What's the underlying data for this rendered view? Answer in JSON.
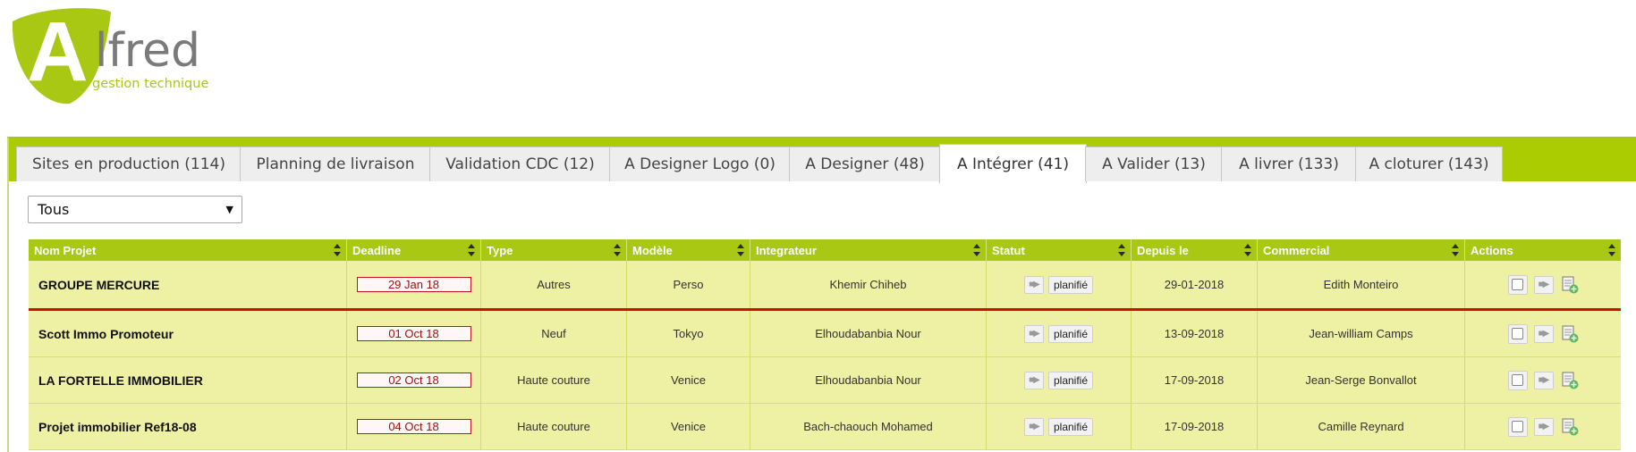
{
  "logo": {
    "letter": "A",
    "name": "lfred",
    "tagline": "gestion technique",
    "brand_color": "#a9c813"
  },
  "tabs": [
    {
      "label": "Sites en production (114)",
      "active": false
    },
    {
      "label": "Planning de livraison",
      "active": false
    },
    {
      "label": "Validation CDC (12)",
      "active": false
    },
    {
      "label": "A Designer Logo (0)",
      "active": false
    },
    {
      "label": "A Designer (48)",
      "active": false
    },
    {
      "label": "A Intégrer (41)",
      "active": true
    },
    {
      "label": "A Valider (13)",
      "active": false
    },
    {
      "label": "A livrer (133)",
      "active": false
    },
    {
      "label": "A cloturer (143)",
      "active": false
    }
  ],
  "filter": {
    "selected": "Tous"
  },
  "table": {
    "columns": [
      "Nom Projet",
      "Deadline",
      "Type",
      "Modèle",
      "Integrateur",
      "Statut",
      "Depuis le",
      "Commercial",
      "Actions"
    ],
    "rows": [
      {
        "name": "GROUPE MERCURE",
        "deadline": "29 Jan 18",
        "type": "Autres",
        "model": "Perso",
        "integrator": "Khemir Chiheb",
        "status": "planifié",
        "since": "29-01-2018",
        "commercial": "Edith Monteiro"
      },
      {
        "name": "Scott Immo Promoteur",
        "deadline": "01 Oct 18",
        "type": "Neuf",
        "model": "Tokyo",
        "integrator": "Elhoudabanbia Nour",
        "status": "planifié",
        "since": "13-09-2018",
        "commercial": "Jean-william Camps"
      },
      {
        "name": "LA FORTELLE IMMOBILIER",
        "deadline": "02 Oct 18",
        "type": "Haute couture",
        "model": "Venice",
        "integrator": "Elhoudabanbia Nour",
        "status": "planifié",
        "since": "17-09-2018",
        "commercial": "Jean-Serge Bonvallot"
      },
      {
        "name": "Projet immobilier Ref18-08",
        "deadline": "04 Oct 18",
        "type": "Haute couture",
        "model": "Venice",
        "integrator": "Bach-chaouch Mohamed",
        "status": "planifié",
        "since": "17-09-2018",
        "commercial": "Camille Reynard"
      }
    ]
  },
  "colors": {
    "accent": "#aacc00",
    "row_bg": "#eef0a4",
    "deadline_red": "#c0141a",
    "separator_red": "#cc1100"
  }
}
